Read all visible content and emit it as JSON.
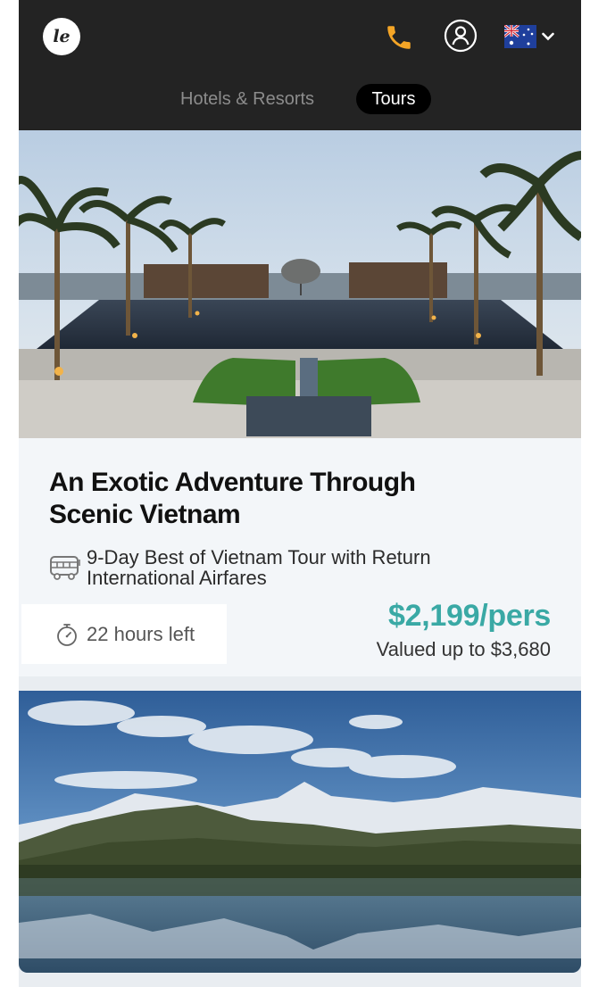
{
  "header": {
    "logo_text": "le",
    "phone_icon": "phone-icon",
    "account_icon": "user-icon",
    "country_flag": "australia-flag-icon",
    "country_dropdown_icon": "chevron-down-icon",
    "colors": {
      "background": "#232323",
      "phone_accent": "#f4a526"
    }
  },
  "tabs": [
    {
      "label": "Hotels & Resorts",
      "active": false
    },
    {
      "label": "Tours",
      "active": true
    }
  ],
  "deals": [
    {
      "image": "resort-pool-palm-trees-image",
      "title": "An Exotic Adventure Through Scenic Vietnam",
      "subtitle": "9-Day Best of Vietnam Tour with Return International Airfares",
      "subtitle_icon": "bus-icon",
      "time_left": "22 hours left",
      "time_icon": "stopwatch-icon",
      "price": "$2,199/pers",
      "valued": "Valued up to $3,680",
      "colors": {
        "price": "#3aa9a5"
      }
    },
    {
      "image": "mountain-lake-reflection-image"
    }
  ]
}
